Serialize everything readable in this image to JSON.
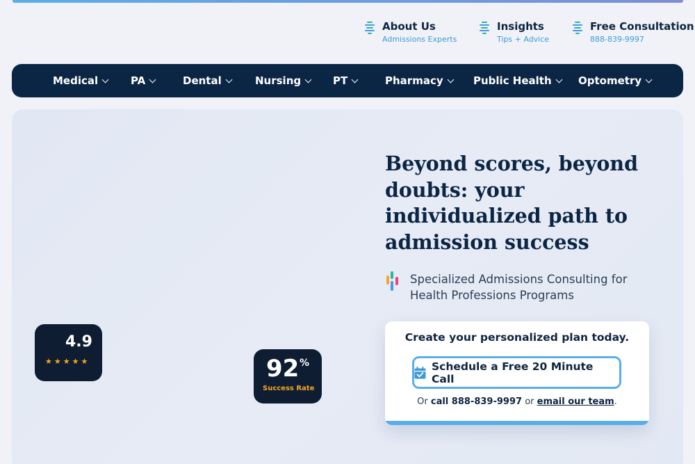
{
  "utility_links": [
    {
      "title": "About Us",
      "subtitle": "Admissions Experts"
    },
    {
      "title": "Insights",
      "subtitle": "Tips + Advice"
    },
    {
      "title": "Free Consultation",
      "subtitle": "888-839-9997"
    }
  ],
  "nav": {
    "items": [
      "Medical",
      "PA",
      "Dental",
      "Nursing",
      "PT",
      "Pharmacy",
      "Public Health",
      "Optometry"
    ]
  },
  "hero": {
    "headline": "Beyond scores, beyond doubts: your individualized path to admission success",
    "subheadline": "Specialized Admissions Consulting for Health Professions Programs"
  },
  "rating_badge": {
    "value": "4.9",
    "stars": "★★★★★",
    "star_count": 5
  },
  "success_badge": {
    "value": "92",
    "unit": "%",
    "label": "Success Rate"
  },
  "cta_card": {
    "title": "Create your personalized plan today.",
    "button_label": "Schedule a Free 20 Minute Call",
    "or_text": "Or",
    "call_text": "call 888-839-9997",
    "or2_text": "or",
    "email_link": "email our team",
    "period": "."
  },
  "colors": {
    "navy": "#0b2545",
    "accent_blue": "#5aaee8",
    "star_gold": "#f5a623",
    "teal": "#27b6a8"
  },
  "icons": {
    "utility": "pulse-lines-icon",
    "button": "calendar-check-icon",
    "subheadline": "colored-bars-icon"
  }
}
